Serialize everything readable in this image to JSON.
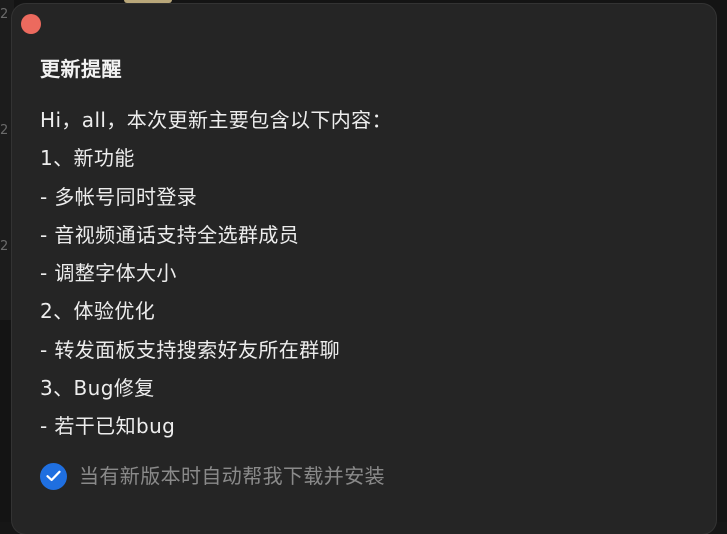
{
  "background": {
    "side_markers": [
      "2",
      "2",
      "2"
    ]
  },
  "dialog": {
    "title": "更新提醒",
    "lines": [
      "Hi，all，本次更新主要包含以下内容：",
      "1、新功能",
      "- 多帐号同时登录",
      "- 音视频通话支持全选群成员",
      "- 调整字体大小",
      "2、体验优化",
      "- 转发面板支持搜索好友所在群聊",
      "3、Bug修复",
      "- 若干已知bug"
    ],
    "auto_update": {
      "checked": true,
      "label": "当有新版本时自动帮我下载并安装"
    }
  },
  "colors": {
    "close": "#ec6a5e",
    "accent": "#1f6fe0",
    "dialog_bg": "#252525"
  }
}
